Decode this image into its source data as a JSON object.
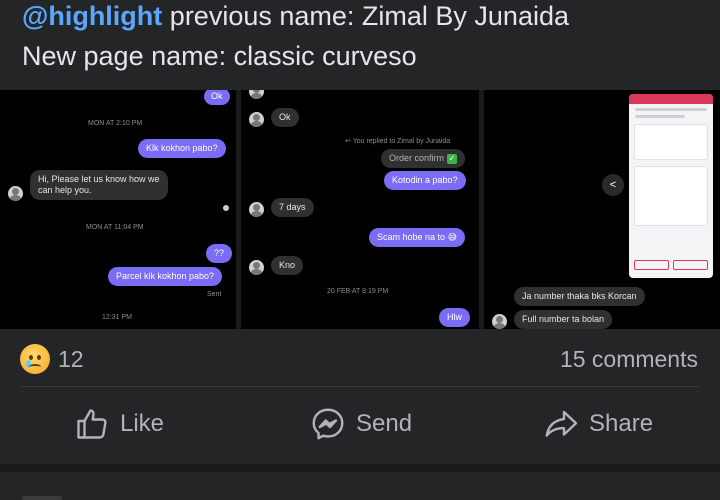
{
  "post": {
    "mention": "@highlight",
    "line1_rest": " previous name: Zimal By Junaida",
    "line2": "New page name: classic curveso"
  },
  "screenshots": {
    "panel1": {
      "bubble_top": "Ok",
      "time1": "MON AT 2:10 PM",
      "msg1": "Klk kokhon pabo?",
      "reply1_line1": "Hi, Please let us know how we",
      "reply1_line2": "can help you.",
      "time2": "MON AT 11:04 PM",
      "msg2": "??",
      "msg3": "Parcel klk kokhon pabo?",
      "sent_label": "Sent",
      "time3": "12:31 PM"
    },
    "panel2": {
      "recv1": "Ok",
      "replied_note": "You replied to Zimal by Junaida",
      "quoted": "Order confirm",
      "msg1": "Kotodin a pabo?",
      "recv2": "7 days",
      "msg2": "Scam hobe na to",
      "recv3": "Kno",
      "time1": "20 FEB AT 8:19 PM",
      "msg3": "Hlw"
    },
    "panel3": {
      "msg1": "Ja number thaka bks Korcan",
      "msg2": "Full number ta bolan"
    }
  },
  "reactions": {
    "count": "12",
    "comments": "15 comments"
  },
  "actions": {
    "like": "Like",
    "send": "Send",
    "share": "Share"
  },
  "colors": {
    "background": "#242526",
    "mention": "#5aa7ff",
    "sent_bubble": "#7a6cf5"
  }
}
